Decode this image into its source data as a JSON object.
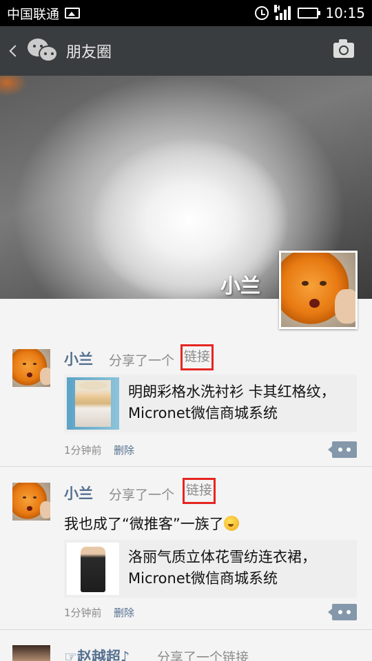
{
  "status_bar": {
    "carrier": "中国联通",
    "time": "10:15",
    "icons": [
      "image-icon",
      "alarm-icon",
      "signal-icon",
      "battery-icon"
    ]
  },
  "header": {
    "title": "朋友圈",
    "icons": [
      "back-icon",
      "wechat-icon",
      "camera-icon"
    ]
  },
  "profile": {
    "name": "小兰"
  },
  "posts": [
    {
      "author": "小兰",
      "action": "分享了一个",
      "link_word": "链接",
      "link_title": "明朗彩格水洗衬衫 卡其红格纹，Micronet微信商城系统",
      "time": "1分钟前",
      "delete": "删除"
    },
    {
      "author": "小兰",
      "action": "分享了一个",
      "link_word": "链接",
      "text": "我也成了“微推客”一族了",
      "link_title": "洛丽气质立体花雪纺连衣裙，Micronet微信商城系统",
      "time": "1分钟前",
      "delete": "删除"
    },
    {
      "author": "☞赵越超♪",
      "action": "分享了一个链接"
    }
  ],
  "colors": {
    "title_bar": "#3a3d3f",
    "name_blue": "#55708f",
    "highlight_red": "#e52521",
    "comment_button": "#8497ab"
  }
}
